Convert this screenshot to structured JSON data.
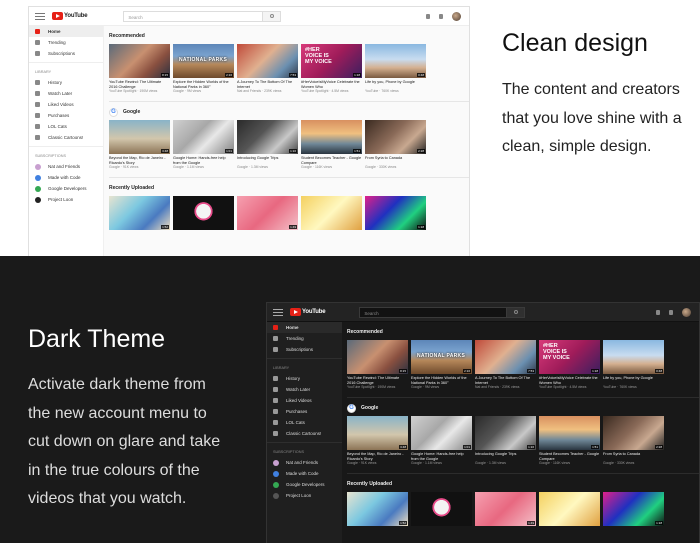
{
  "light_section": {
    "title": "Clean design",
    "body_lines": [
      "The content and creators",
      "that you love shine with a",
      "clean, simple design."
    ]
  },
  "dark_section": {
    "title": "Dark Theme",
    "body_lines": [
      "Activate dark theme from",
      "the new account menu to",
      "cut down on glare and take",
      "in the true colours of the",
      "videos that you watch."
    ]
  },
  "app": {
    "logo_text": "YouTube",
    "search_placeholder": "Search",
    "sidebar_main": [
      "Home",
      "Trending",
      "Subscriptions"
    ],
    "library_header": "LIBRARY",
    "library_items": [
      "History",
      "Watch Later",
      "Liked Videos",
      "Purchases",
      "LOL Cats",
      "Classic Cartoons!"
    ],
    "subscriptions_header": "SUBSCRIPTIONS",
    "subscriptions": [
      {
        "label": "Nat and Friends",
        "color": "#c8a0d0"
      },
      {
        "label": "Made with Code",
        "color": "#4080e0"
      },
      {
        "label": "Google Developers",
        "color": "#34a853"
      },
      {
        "label": "Project Loon",
        "color": "#222222"
      }
    ],
    "sections": {
      "recommended": "Recommended",
      "google": "Google",
      "recently": "Recently Uploaded"
    },
    "recommended_videos": [
      {
        "title": "YouTube Rewind: The Ultimate 2016 Challenge",
        "meta": "YouTube Spotlight · 190M views",
        "duration": "8:15"
      },
      {
        "title": "Explore the Hidden Worlds of the National Parks in 360°",
        "meta": "Google · 9M views",
        "duration": "2:16",
        "overlay": "NATIONAL PARKS"
      },
      {
        "title": "A Journey To The Bottom Of The Internet",
        "meta": "Nat and Friends · 239K views",
        "duration": "7:53"
      },
      {
        "title": "#HerVoiceIsMyVoice Celebrate the Women Who",
        "meta": "YouTube Spotlight · 4.5M views",
        "duration": "1:18",
        "overlay": "#HER VOICE IS MY VOICE"
      },
      {
        "title": "Life by you, Phone by Google",
        "meta": "YouTube · 760K views",
        "duration": "0:48"
      }
    ],
    "google_videos": [
      {
        "title": "Beyond the Map, Rio de Janeiro - Ricardo's Story",
        "meta": "Google · 91K views",
        "duration": "3:48"
      },
      {
        "title": "Google Home: Hands-free help from the Google",
        "meta": "Google · 1.1M views",
        "duration": "1:01"
      },
      {
        "title": "Introducing Google Trips",
        "meta": "Google · 1.3M views",
        "duration": "1:16"
      },
      {
        "title": "Student Becomes Teacher - Google Compare",
        "meta": "Google · 116K views",
        "duration": "1:51"
      },
      {
        "title": "From Syria to Canada",
        "meta": "Google · 330K views",
        "duration": "2:28"
      }
    ],
    "recent_durations": [
      "1:52",
      "",
      "1:49",
      "",
      "1:18"
    ]
  }
}
